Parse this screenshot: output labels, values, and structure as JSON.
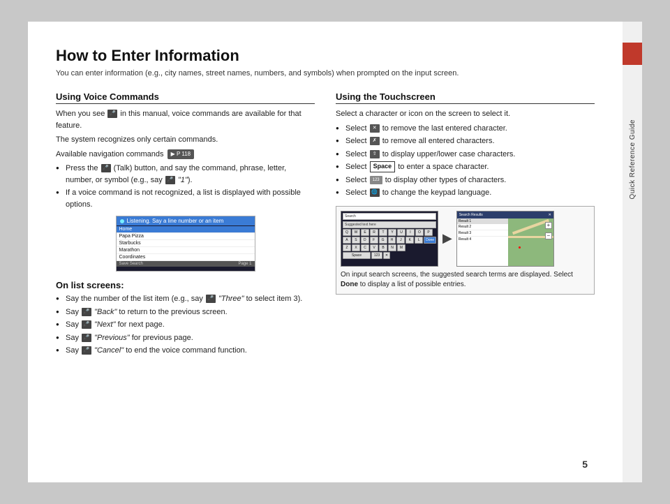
{
  "page": {
    "title": "How to Enter Information",
    "subtitle": "You can enter information (e.g., city names, street names, numbers, and symbols) when prompted on the input screen.",
    "page_number": "5",
    "side_label": "Quick Reference Guide"
  },
  "left_section": {
    "title": "Using Voice Commands",
    "para1": "When you see  in this manual, voice commands are available for that feature.",
    "para2": "The system recognizes only certain commands.",
    "para3": "Available navigation commands",
    "bullet1": "(Talk) button, and say the command, phrase, letter, number, or symbol (e.g., say  \"1\").",
    "bullet1_prefix": "Press the",
    "bullet2": "If a voice command is not recognized, a list is displayed with possible options.",
    "on_list_title": "On list screens:",
    "list_bullets": [
      "Say the number of the list item (e.g., say  \"Three\" to select item 3).",
      "Say  \"Back\" to return to the previous screen.",
      "Say  \"Next\" for next page.",
      "Say  \"Previous\" for previous page.",
      "Say  \"Cancel\" to end the voice command function."
    ],
    "voice_screen": {
      "header": "Listening. Say a line number or an item",
      "items": [
        "Home",
        "Papa Pizza",
        "Starbucks",
        "Marathon",
        "Coordinates"
      ]
    }
  },
  "right_section": {
    "title": "Using the Touchscreen",
    "intro": "Select a character or icon on the screen to select it.",
    "bullets": [
      "Select  to remove the last entered character.",
      "Select  to remove all entered characters.",
      "Select  to display upper/lower case characters.",
      "Select Space to enter a space character.",
      "Select  to display other types of characters.",
      "Select  to change the keypad language."
    ],
    "caption": "On input search screens, the suggested search terms are displayed. Select Done to display a list of possible entries."
  }
}
